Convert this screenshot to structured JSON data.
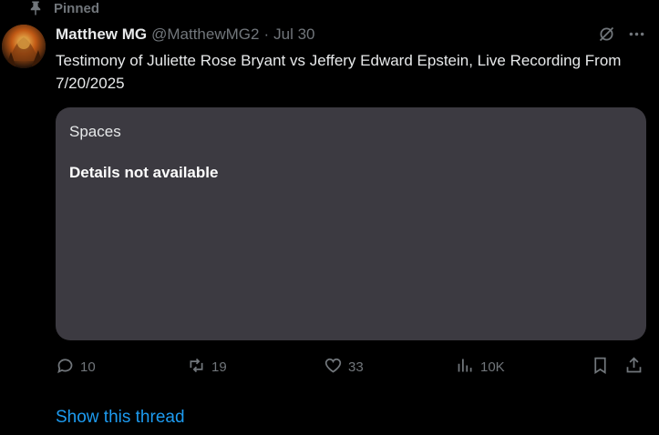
{
  "pinned": {
    "label": "Pinned",
    "icon": "pin-icon"
  },
  "tweet": {
    "display_name": "Matthew MG",
    "handle": "@MatthewMG2",
    "separator": "·",
    "date": "Jul 30",
    "text": "Testimony of Juliette Rose Bryant vs Jeffery Edward Epstein, Live Recording From 7/20/2025"
  },
  "spaces_card": {
    "label": "Spaces",
    "detail": "Details not available",
    "background": "#3c3a41"
  },
  "actions": {
    "replies": "10",
    "reposts": "19",
    "likes": "33",
    "views": "10K"
  },
  "show_thread": "Show this thread",
  "colors": {
    "background": "#000000",
    "text": "#e7e9ea",
    "muted": "#71767b",
    "link": "#1d9bf0"
  }
}
